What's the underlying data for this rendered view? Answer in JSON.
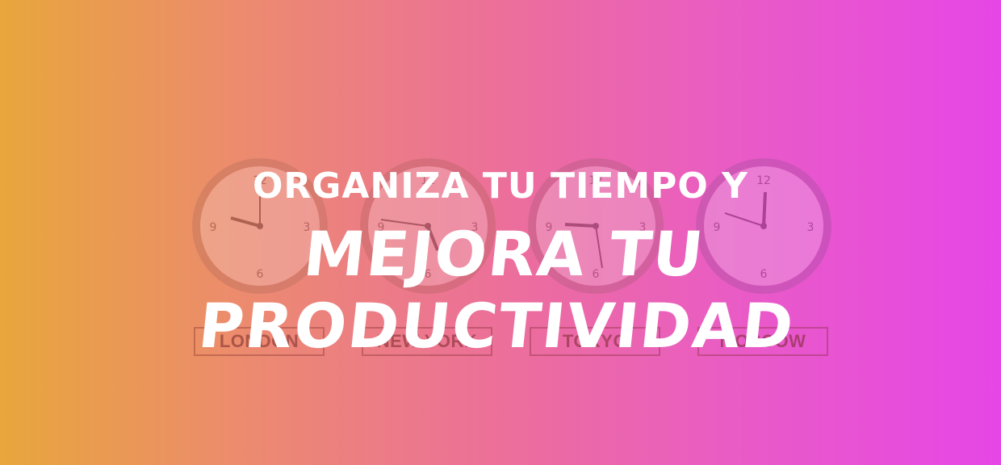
{
  "headline": {
    "line1": "ORGANIZA TU TIEMPO Y",
    "line2": "MEJORA TU PRODUCTIVIDAD"
  },
  "cities": [
    {
      "label": "LONDON"
    },
    {
      "label": "NEW YORK"
    },
    {
      "label": "TOKYO"
    },
    {
      "label": "MOSCOW"
    }
  ],
  "colors": {
    "gradient_start": "#e8a63c",
    "gradient_end": "#e646e6",
    "text": "#ffffff"
  }
}
